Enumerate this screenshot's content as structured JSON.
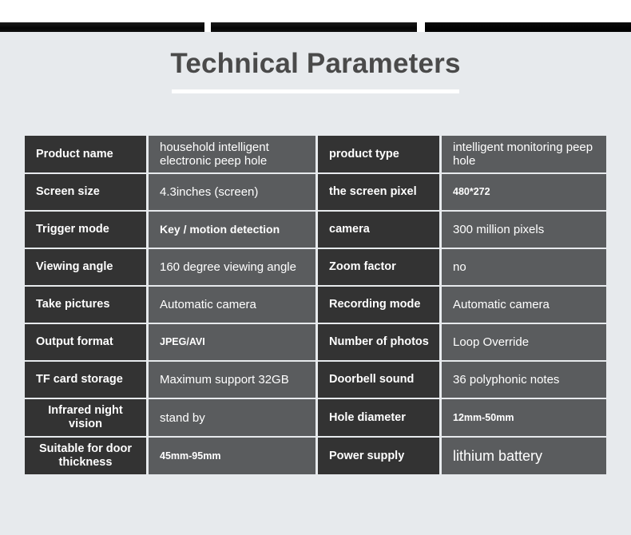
{
  "header": {
    "title": "Technical Parameters"
  },
  "photo_strip": {
    "panels": [
      "product-photo-1",
      "product-photo-2",
      "product-photo-3"
    ]
  },
  "spec_table": {
    "rows": [
      {
        "left_label": "Product name",
        "left_value": "household intelligent electronic peep hole",
        "right_label": "product type",
        "right_value": "intelligent monitoring peep hole",
        "left_label_style": "normal",
        "left_value_style": "normal",
        "right_value_style": "normal"
      },
      {
        "left_label": "Screen size",
        "left_value": "4.3inches (screen)",
        "right_label": "the screen pixel",
        "right_value": "480*272",
        "left_label_style": "normal",
        "left_value_style": "normal",
        "right_value_style": "small-bold"
      },
      {
        "left_label": "Trigger mode",
        "left_value": "Key / motion detection",
        "right_label": "camera",
        "right_value": "300 million pixels",
        "left_label_style": "normal",
        "left_value_style": "bold",
        "right_value_style": "normal"
      },
      {
        "left_label": "Viewing angle",
        "left_value": "160 degree viewing angle",
        "right_label": "Zoom factor",
        "right_value": "no",
        "left_label_style": "normal",
        "left_value_style": "normal",
        "right_value_style": "normal"
      },
      {
        "left_label": "Take pictures",
        "left_value": "Automatic camera",
        "right_label": "Recording mode",
        "right_value": "Automatic camera",
        "left_label_style": "normal",
        "left_value_style": "normal",
        "right_value_style": "normal"
      },
      {
        "left_label": "Output format",
        "left_value": "JPEG/AVI",
        "right_label": "Number of photos",
        "right_value": "Loop Override",
        "left_label_style": "normal",
        "left_value_style": "small-bold",
        "right_value_style": "normal"
      },
      {
        "left_label": "TF card storage",
        "left_value": "Maximum support 32GB",
        "right_label": "Doorbell sound",
        "right_value": "36 polyphonic notes",
        "left_label_style": "normal",
        "left_value_style": "normal",
        "right_value_style": "normal"
      },
      {
        "left_label": "Infrared night vision",
        "left_value": "stand by",
        "right_label": "Hole diameter",
        "right_value": "12mm-50mm",
        "left_label_style": "center-2l",
        "left_value_style": "normal",
        "right_value_style": "small-bold"
      },
      {
        "left_label": "Suitable for door thickness",
        "left_value": "45mm-95mm",
        "right_label": "Power supply",
        "right_value": "lithium battery",
        "left_label_style": "center-2l",
        "left_value_style": "small-bold",
        "right_value_style": "big"
      }
    ]
  },
  "colors": {
    "background": "#e7eaed",
    "label_cell": "#333333",
    "value_cell": "#5a5c5e",
    "title_text": "#4a4a4a",
    "underline": "#ffffff",
    "cell_text": "#ffffff"
  }
}
